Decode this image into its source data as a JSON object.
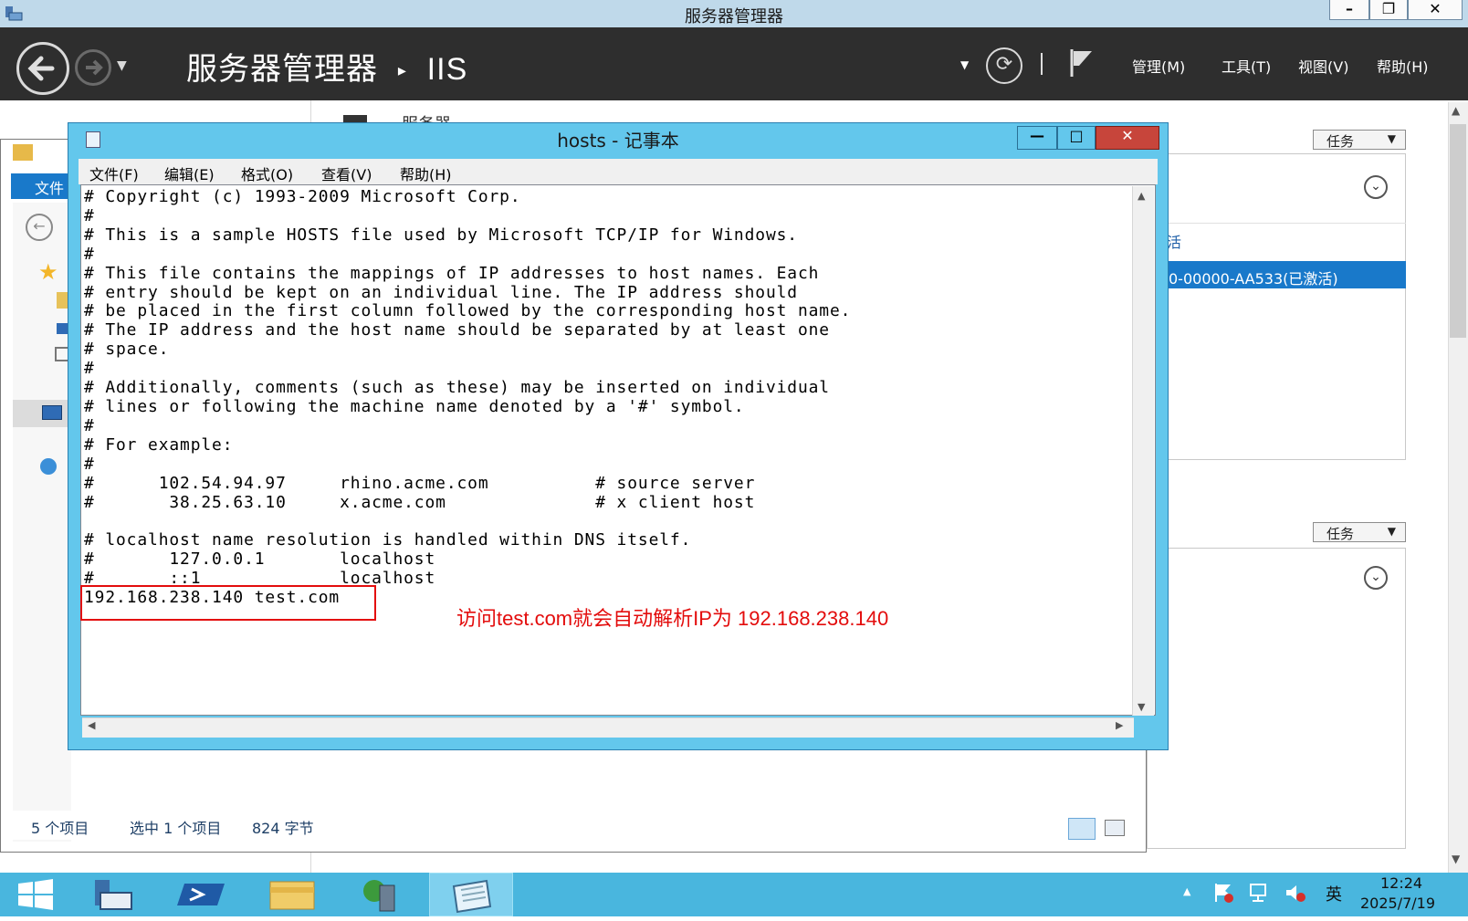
{
  "server_manager": {
    "window_title": "服务器管理器",
    "breadcrumb_root": "服务器管理器",
    "breadcrumb_sep": "▸",
    "breadcrumb_leaf": "IIS",
    "menus": [
      "管理(M)",
      "工具(T)",
      "视图(V)",
      "帮助(H)"
    ],
    "window_controls": {
      "minimize": "–",
      "restore": "❐",
      "close": "✕"
    },
    "section_title": "服务器",
    "tasks_label": "任务",
    "partial_text_1": "活",
    "selected_row_text": "0-00000-AA533(已激活)"
  },
  "explorer": {
    "ribbon_file": "文件",
    "status_items": "5 个项目",
    "status_selected": "选中 1 个项目",
    "status_size": "824 字节"
  },
  "notepad": {
    "title": "hosts - 记事本",
    "menus": [
      "文件(F)",
      "编辑(E)",
      "格式(O)",
      "查看(V)",
      "帮助(H)"
    ],
    "controls": {
      "minimize": "—",
      "maximize": "□",
      "close": "✕"
    },
    "content": "# Copyright (c) 1993-2009 Microsoft Corp.\n#\n# This is a sample HOSTS file used by Microsoft TCP/IP for Windows.\n#\n# This file contains the mappings of IP addresses to host names. Each\n# entry should be kept on an individual line. The IP address should\n# be placed in the first column followed by the corresponding host name.\n# The IP address and the host name should be separated by at least one\n# space.\n#\n# Additionally, comments (such as these) may be inserted on individual\n# lines or following the machine name denoted by a '#' symbol.\n#\n# For example:\n#\n#      102.54.94.97     rhino.acme.com          # source server\n#       38.25.63.10     x.acme.com              # x client host\n\n# localhost name resolution is handled within DNS itself.\n#       127.0.0.1       localhost\n#       ::1             localhost\n192.168.238.140 test.com"
  },
  "annotation": {
    "text": "访问test.com就会自动解析IP为 192.168.238.140",
    "color": "#e30c0c"
  },
  "taskbar": {
    "time": "12:24",
    "date": "2025/7/19",
    "ime": "英",
    "tray_up_icon": "▲"
  },
  "colors": {
    "titlebar": "#bfd9ea",
    "header": "#2e2e2e",
    "notepad_frame": "#63c7ec",
    "taskbar": "#49b6de",
    "selection": "#1979ca",
    "close_red": "#c7453b"
  }
}
